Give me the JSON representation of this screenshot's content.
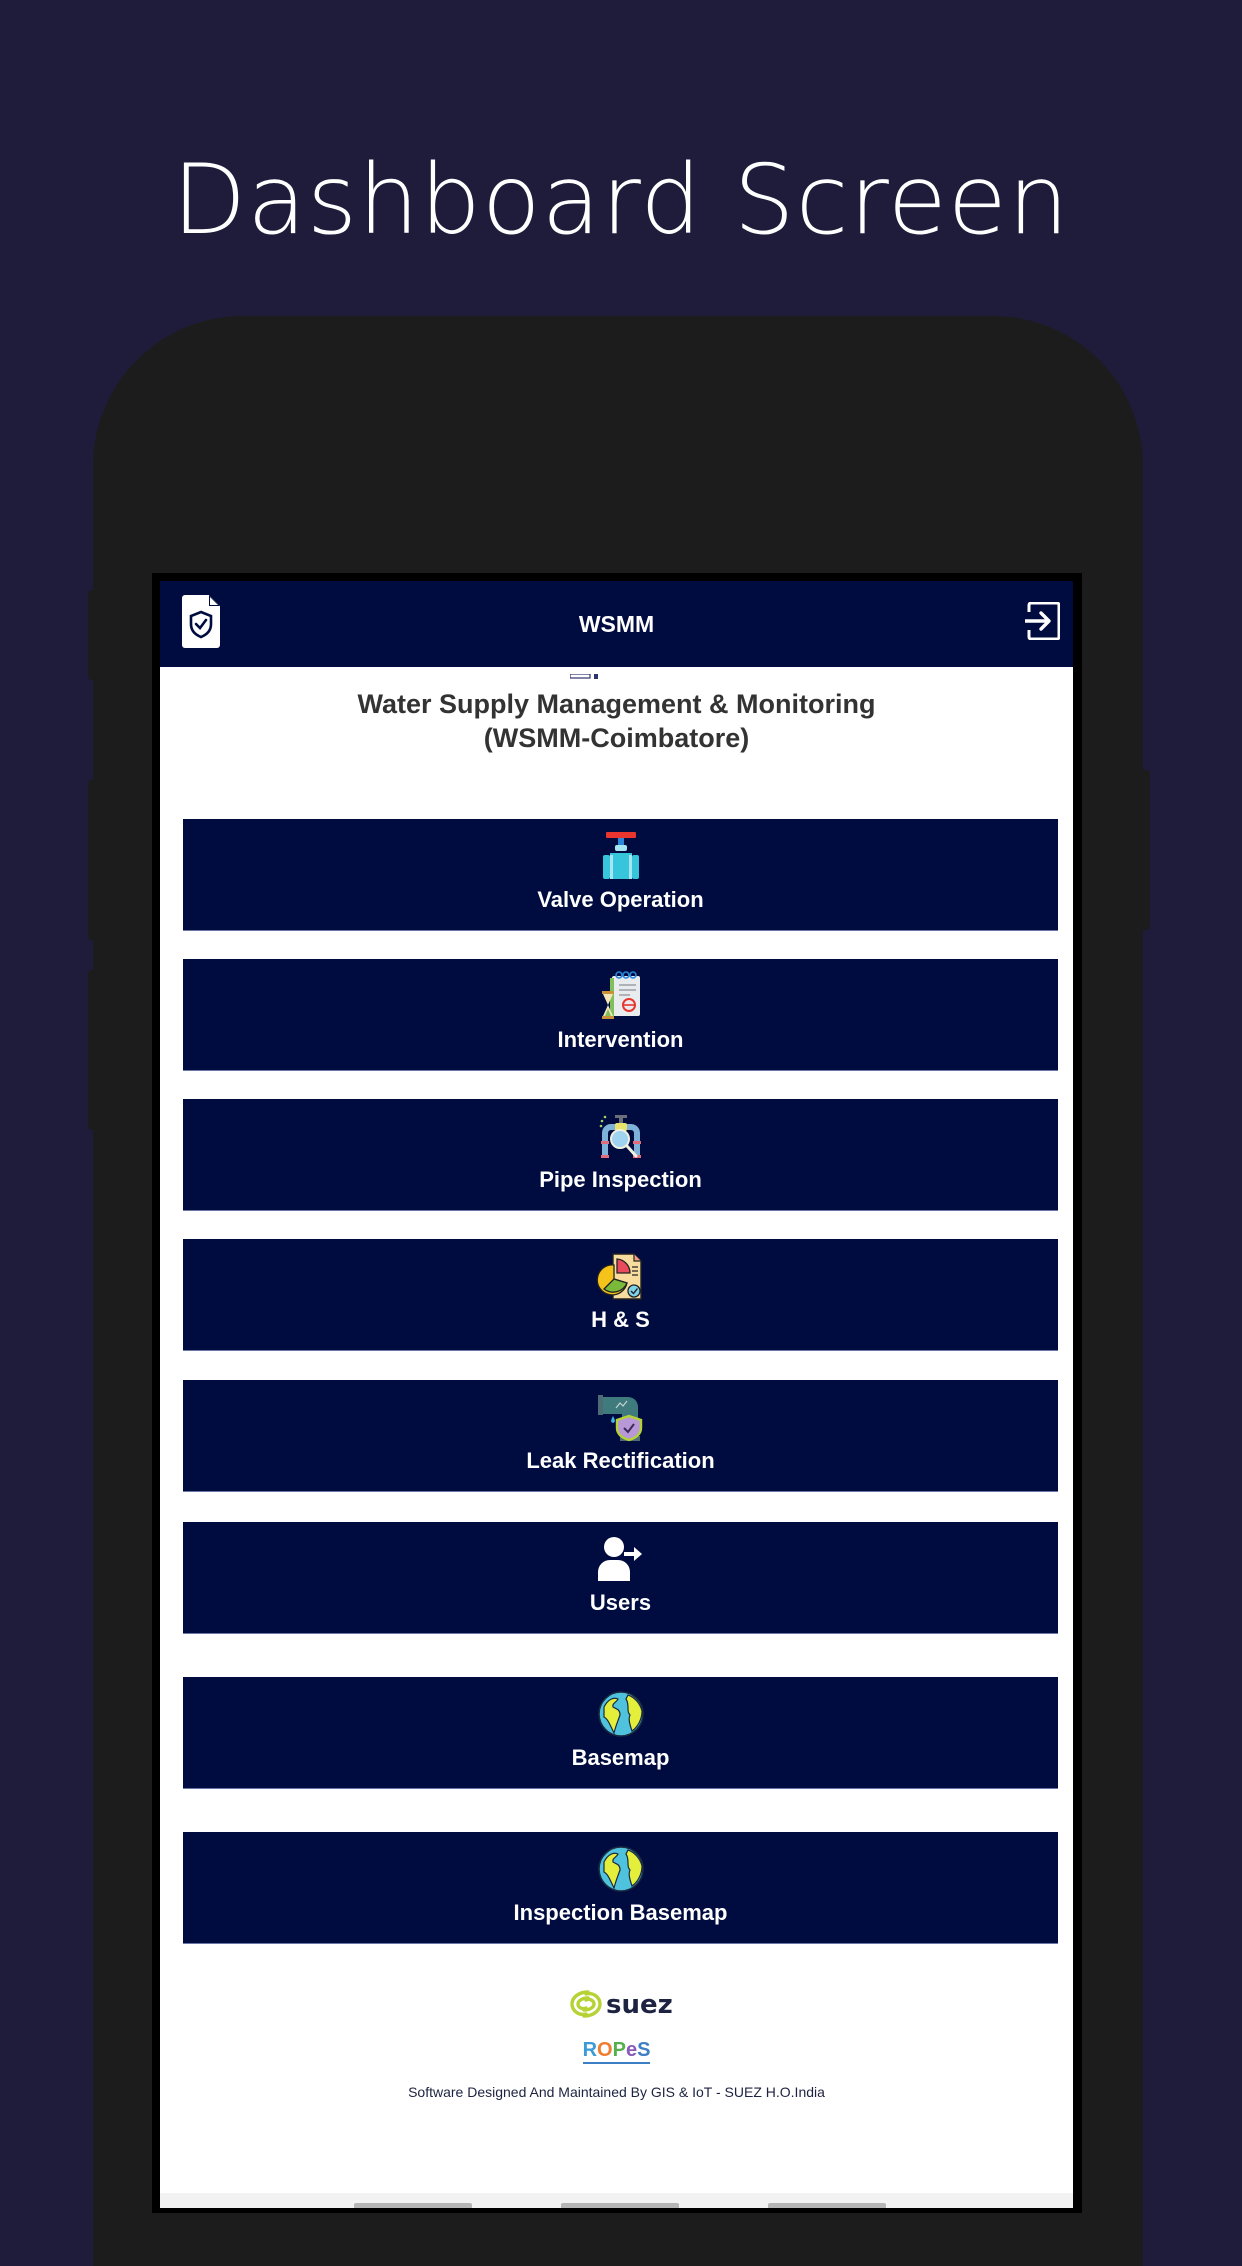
{
  "promo": {
    "title": "Dashboard Screen"
  },
  "header": {
    "title": "WSMM",
    "left_icon": "document-shield-check-icon",
    "right_icon": "logout-icon"
  },
  "app_title": {
    "line1": "Water Supply Management & Monitoring",
    "line2": "(WSMM-Coimbatore)"
  },
  "menu": [
    {
      "label": "Valve Operation",
      "icon": "valve-icon"
    },
    {
      "label": "Intervention",
      "icon": "notepad-hourglass-icon"
    },
    {
      "label": "Pipe Inspection",
      "icon": "pipe-magnifier-icon"
    },
    {
      "label": "H & S",
      "icon": "report-pie-chart-icon"
    },
    {
      "label": "Leak Rectification",
      "icon": "leaking-pipe-shield-icon"
    },
    {
      "label": "Users",
      "icon": "user-arrow-icon"
    },
    {
      "label": "Basemap",
      "icon": "globe-icon"
    },
    {
      "label": "Inspection Basemap",
      "icon": "globe-icon"
    }
  ],
  "footer": {
    "brand_logo": "suez",
    "product_logo": {
      "letters": [
        "R",
        "O",
        "P",
        "e",
        "S"
      ]
    },
    "note": "Software Designed And Maintained By GIS & IoT - SUEZ H.O.India"
  },
  "colors": {
    "page_bg": "#1e1c3a",
    "phone_body": "#1c1c1c",
    "header_bg": "#000c3f",
    "button_bg": "#000c3f",
    "title_text": "#333333",
    "suez_green": "#b5d334",
    "suez_navy": "#1d2340"
  }
}
